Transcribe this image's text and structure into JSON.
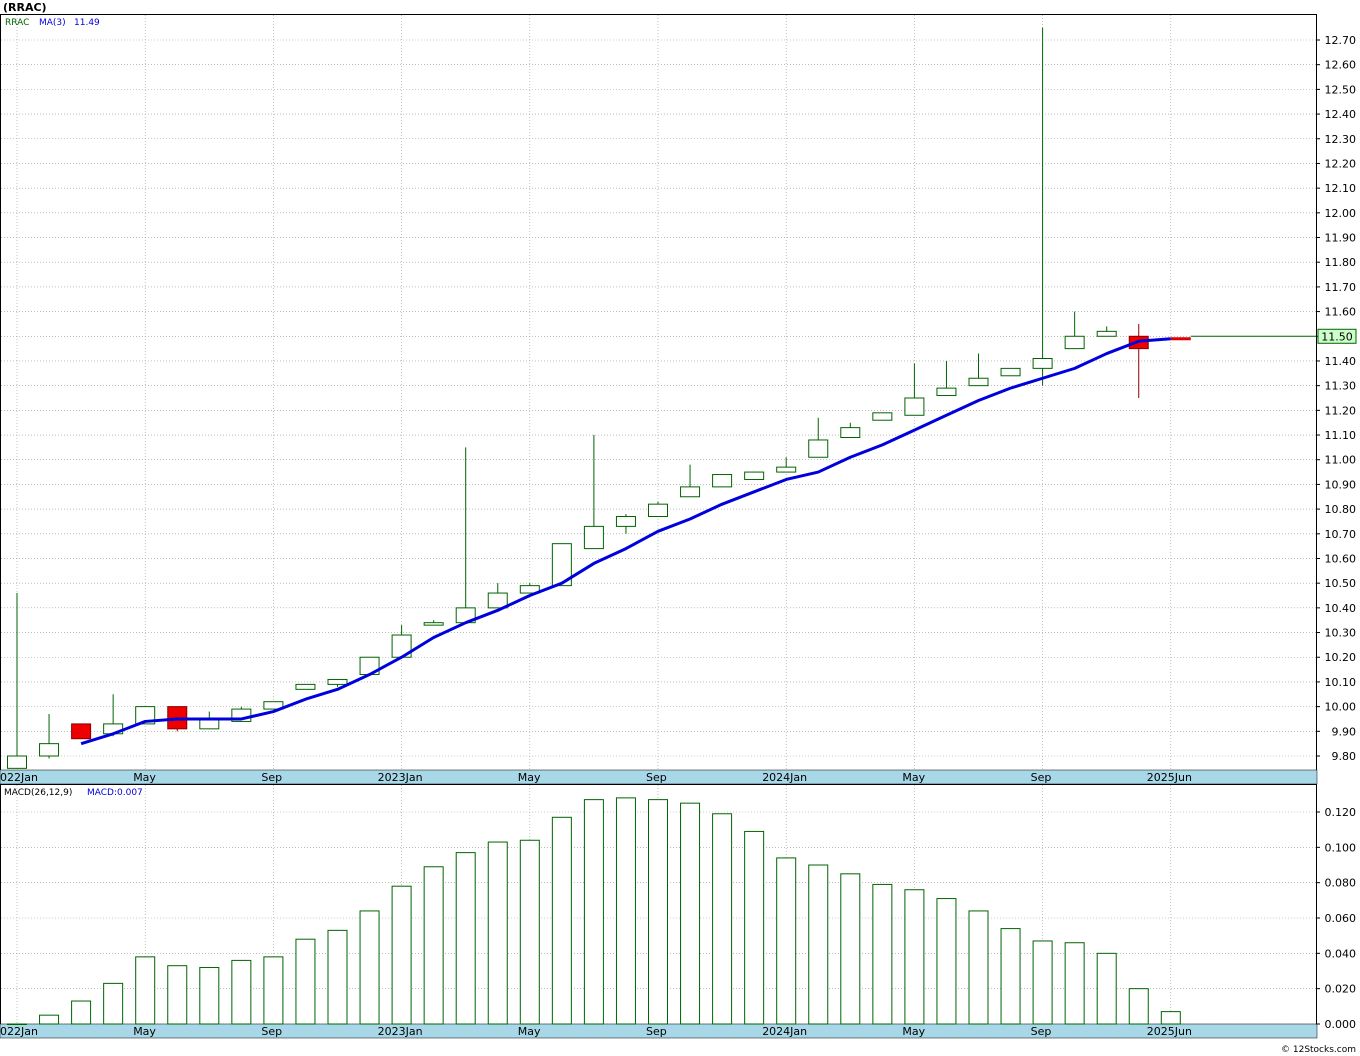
{
  "header": {
    "title": "(RRAC)"
  },
  "price_panel": {
    "legend_symbol": "RRAC",
    "legend_ma": "MA(3)",
    "legend_ma_value": "11.49",
    "last_price_label": "11.50"
  },
  "macd_panel": {
    "legend_params": "MACD(26,12,9)",
    "legend_value": "MACD:0.007"
  },
  "footer": {
    "copyright": "© 12Stocks.com"
  },
  "colors": {
    "up_candle_border": "#006400",
    "down_candle_fill": "#ee0000",
    "ma_line": "#0000dd",
    "ma_line_recent": "#dd0000",
    "axis_band": "#a8d8e8",
    "grid": "#999999",
    "price_tag_fill": "#ccffcc",
    "macd_bar": "#006400"
  },
  "chart_data": [
    {
      "type": "candlestick",
      "title": "(RRAC)",
      "period": "monthly",
      "xaxis_ticks": [
        "2022Jan",
        "May",
        "Sep",
        "2023Jan",
        "May",
        "Sep",
        "2024Jan",
        "May",
        "Sep",
        "2025Jun"
      ],
      "ylim": [
        9.76,
        12.8
      ],
      "yticks": [
        9.8,
        9.9,
        10.0,
        10.1,
        10.2,
        10.3,
        10.4,
        10.5,
        10.6,
        10.7,
        10.8,
        10.9,
        11.0,
        11.1,
        11.2,
        11.3,
        11.4,
        11.5,
        11.6,
        11.7,
        11.8,
        11.9,
        12.0,
        12.1,
        12.2,
        12.3,
        12.4,
        12.5,
        12.6,
        12.7
      ],
      "grid": true,
      "candles": [
        {
          "open": 9.75,
          "high": 10.46,
          "low": 9.75,
          "close": 9.8
        },
        {
          "open": 9.8,
          "high": 9.97,
          "low": 9.79,
          "close": 9.85
        },
        {
          "open": 9.93,
          "high": 9.93,
          "low": 9.87,
          "close": 9.87
        },
        {
          "open": 9.89,
          "high": 10.05,
          "low": 9.88,
          "close": 9.93
        },
        {
          "open": 9.93,
          "high": 10.0,
          "low": 9.93,
          "close": 10.0
        },
        {
          "open": 10.0,
          "high": 10.0,
          "low": 9.9,
          "close": 9.91
        },
        {
          "open": 9.91,
          "high": 9.98,
          "low": 9.91,
          "close": 9.95
        },
        {
          "open": 9.94,
          "high": 10.0,
          "low": 9.94,
          "close": 9.99
        },
        {
          "open": 9.99,
          "high": 10.02,
          "low": 9.99,
          "close": 10.02
        },
        {
          "open": 10.07,
          "high": 10.09,
          "low": 10.07,
          "close": 10.09
        },
        {
          "open": 10.09,
          "high": 10.11,
          "low": 10.08,
          "close": 10.11
        },
        {
          "open": 10.13,
          "high": 10.2,
          "low": 10.13,
          "close": 10.2
        },
        {
          "open": 10.2,
          "high": 10.33,
          "low": 10.2,
          "close": 10.29
        },
        {
          "open": 10.33,
          "high": 10.35,
          "low": 10.33,
          "close": 10.34
        },
        {
          "open": 10.34,
          "high": 11.05,
          "low": 10.34,
          "close": 10.4
        },
        {
          "open": 10.4,
          "high": 10.5,
          "low": 10.4,
          "close": 10.46
        },
        {
          "open": 10.46,
          "high": 10.5,
          "low": 10.46,
          "close": 10.49
        },
        {
          "open": 10.49,
          "high": 10.66,
          "low": 10.49,
          "close": 10.66
        },
        {
          "open": 10.64,
          "high": 11.1,
          "low": 10.64,
          "close": 10.73
        },
        {
          "open": 10.73,
          "high": 10.78,
          "low": 10.7,
          "close": 10.77
        },
        {
          "open": 10.77,
          "high": 10.83,
          "low": 10.77,
          "close": 10.82
        },
        {
          "open": 10.85,
          "high": 10.98,
          "low": 10.85,
          "close": 10.89
        },
        {
          "open": 10.89,
          "high": 10.94,
          "low": 10.89,
          "close": 10.94
        },
        {
          "open": 10.92,
          "high": 10.95,
          "low": 10.92,
          "close": 10.95
        },
        {
          "open": 10.95,
          "high": 11.01,
          "low": 10.95,
          "close": 10.97
        },
        {
          "open": 11.01,
          "high": 11.17,
          "low": 11.01,
          "close": 11.08
        },
        {
          "open": 11.09,
          "high": 11.15,
          "low": 11.09,
          "close": 11.13
        },
        {
          "open": 11.16,
          "high": 11.19,
          "low": 11.16,
          "close": 11.19
        },
        {
          "open": 11.18,
          "high": 11.39,
          "low": 11.18,
          "close": 11.25
        },
        {
          "open": 11.26,
          "high": 11.4,
          "low": 11.26,
          "close": 11.29
        },
        {
          "open": 11.3,
          "high": 11.43,
          "low": 11.3,
          "close": 11.33
        },
        {
          "open": 11.34,
          "high": 11.37,
          "low": 11.34,
          "close": 11.37
        },
        {
          "open": 11.37,
          "high": 12.75,
          "low": 11.3,
          "close": 11.41
        },
        {
          "open": 11.45,
          "high": 11.6,
          "low": 11.45,
          "close": 11.5
        },
        {
          "open": 11.5,
          "high": 11.54,
          "low": 11.5,
          "close": 11.52
        },
        {
          "open": 11.5,
          "high": 11.55,
          "low": 11.25,
          "close": 11.45
        }
      ],
      "moving_average": {
        "name": "MA(3)",
        "start_index": 2,
        "values": [
          9.85,
          9.89,
          9.94,
          9.95,
          9.95,
          9.95,
          9.98,
          10.03,
          10.07,
          10.13,
          10.2,
          10.28,
          10.34,
          10.39,
          10.45,
          10.5,
          10.58,
          10.64,
          10.71,
          10.76,
          10.82,
          10.87,
          10.92,
          10.95,
          11.01,
          11.06,
          11.12,
          11.18,
          11.24,
          11.29,
          11.33,
          11.37,
          11.43,
          11.48,
          11.49
        ],
        "recent_segment_color": "#dd0000",
        "last_value": 11.49
      },
      "last_price": 11.5
    },
    {
      "type": "bar",
      "title": "MACD(26,12,9)",
      "ylim": [
        -0.005,
        0.13
      ],
      "yticks": [
        0.0,
        0.02,
        0.04,
        0.06,
        0.08,
        0.1,
        0.12
      ],
      "xaxis_ticks": [
        "2022Jan",
        "May",
        "Sep",
        "2023Jan",
        "May",
        "Sep",
        "2024Jan",
        "May",
        "Sep",
        "2025Jun"
      ],
      "grid": true,
      "series": [
        {
          "name": "MACD",
          "values": [
            0.0,
            0.005,
            0.013,
            0.023,
            0.038,
            0.033,
            0.032,
            0.036,
            0.038,
            0.048,
            0.053,
            0.064,
            0.078,
            0.089,
            0.097,
            0.103,
            0.104,
            0.117,
            0.127,
            0.128,
            0.127,
            0.125,
            0.119,
            0.109,
            0.094,
            0.09,
            0.085,
            0.079,
            0.076,
            0.071,
            0.064,
            0.054,
            0.047,
            0.046,
            0.04,
            0.02,
            0.007
          ]
        }
      ],
      "last_value": 0.007
    }
  ]
}
